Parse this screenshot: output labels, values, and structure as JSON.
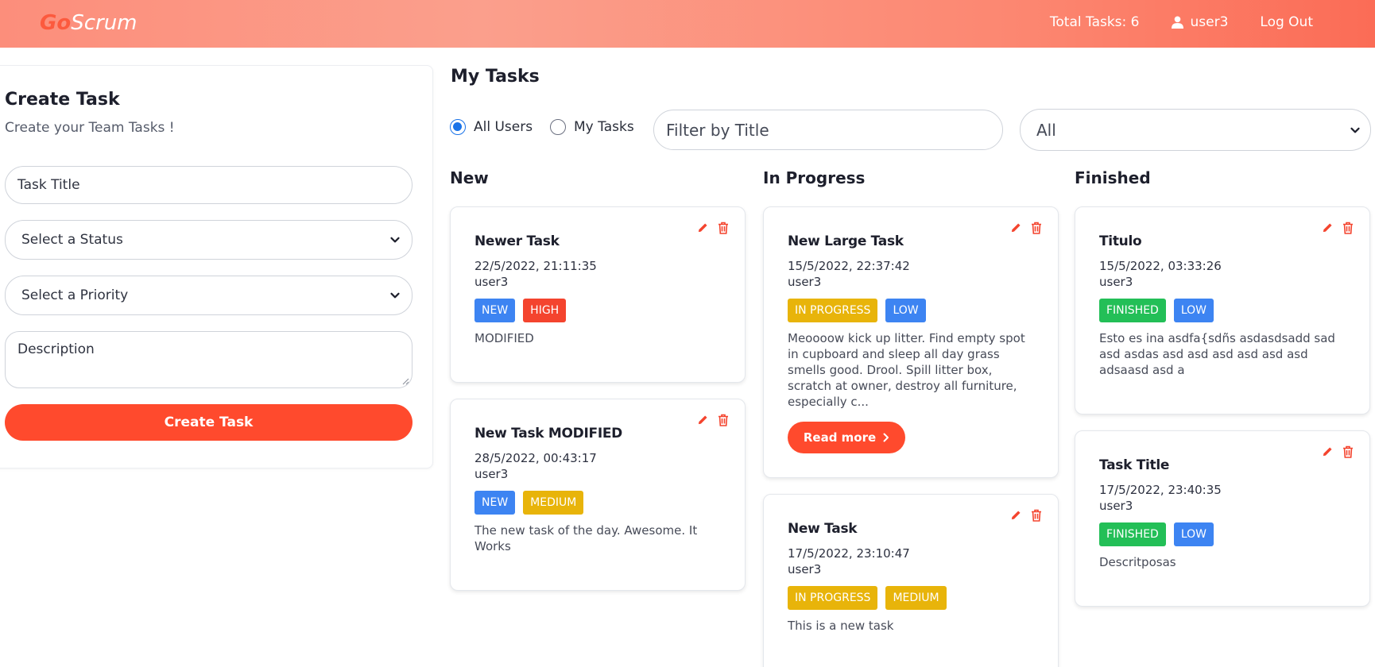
{
  "header": {
    "logo_go": "Go",
    "logo_scrum": "Scrum",
    "total_tasks": "Total Tasks: 6",
    "username": "user3",
    "logout": "Log Out"
  },
  "create": {
    "title": "Create Task",
    "subtitle": "Create your Team Tasks !",
    "title_placeholder": "Task Title",
    "status_placeholder": "Select a Status",
    "priority_placeholder": "Select a Priority",
    "description_placeholder": "Description",
    "button": "Create Task"
  },
  "main": {
    "title": "My Tasks",
    "radio_all": "All Users",
    "radio_mine": "My Tasks",
    "filter_placeholder": "Filter by Title",
    "priority_filter_value": "All"
  },
  "columns": [
    {
      "name": "New",
      "cards": [
        {
          "title": "Newer Task",
          "date": "22/5/2022, 21:11:35",
          "user": "user3",
          "status": "NEW",
          "priority": "HIGH",
          "description": "MODIFIED"
        },
        {
          "title": "New Task MODIFIED",
          "date": "28/5/2022, 00:43:17",
          "user": "user3",
          "status": "NEW",
          "priority": "MEDIUM",
          "description": "The new task of the day. Awesome. It Works"
        }
      ]
    },
    {
      "name": "In Progress",
      "cards": [
        {
          "title": "New Large Task",
          "date": "15/5/2022, 22:37:42",
          "user": "user3",
          "status": "IN PROGRESS",
          "priority": "LOW",
          "description": "Meoooow kick up litter. Find empty spot in cupboard and sleep all day grass smells good. Drool. Spill litter box, scratch at owner, destroy all furniture, especially c...",
          "read_more": "Read more"
        },
        {
          "title": "New Task",
          "date": "17/5/2022, 23:10:47",
          "user": "user3",
          "status": "IN PROGRESS",
          "priority": "MEDIUM",
          "description": "This is a new task"
        }
      ]
    },
    {
      "name": "Finished",
      "cards": [
        {
          "title": "Titulo",
          "date": "15/5/2022, 03:33:26",
          "user": "user3",
          "status": "FINISHED",
          "priority": "LOW",
          "description": "Esto es ina asdfa{sdñs asdasdsadd sad asd asdas asd asd asd asd asd asd adsaasd asd a"
        },
        {
          "title": "Task Title",
          "date": "17/5/2022, 23:40:35",
          "user": "user3",
          "status": "FINISHED",
          "priority": "LOW",
          "description": "Descritposas"
        }
      ]
    }
  ],
  "colors": {
    "accent": "#ff4a2d",
    "badge_new": "#3d84f2",
    "badge_high": "#f4442e",
    "badge_in_progress": "#e8b40a",
    "badge_finished": "#23bf57",
    "badge_low": "#3d84f2",
    "badge_medium": "#e8b40a"
  },
  "icons": {
    "user": "user-icon",
    "edit": "pencil-icon",
    "delete": "trash-icon",
    "chevron": "chevron-down-icon",
    "arrow": "chevron-right-icon"
  }
}
